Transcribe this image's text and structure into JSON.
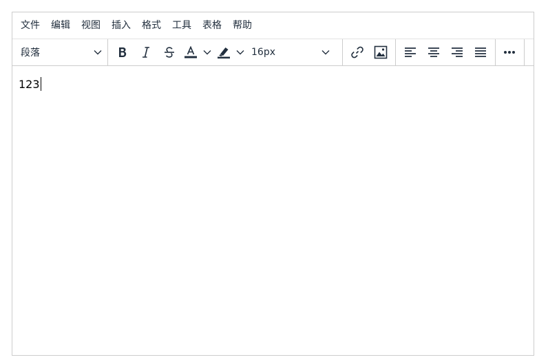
{
  "menubar": {
    "items": [
      {
        "id": "file",
        "label": "文件"
      },
      {
        "id": "edit",
        "label": "编辑"
      },
      {
        "id": "view",
        "label": "视图"
      },
      {
        "id": "insert",
        "label": "插入"
      },
      {
        "id": "format",
        "label": "格式"
      },
      {
        "id": "tools",
        "label": "工具"
      },
      {
        "id": "table",
        "label": "表格"
      },
      {
        "id": "help",
        "label": "帮助"
      }
    ]
  },
  "toolbar": {
    "block_format": "段落",
    "font_size": "16px",
    "icons": {
      "bold": "bold-icon",
      "italic": "italic-icon",
      "strikethrough": "strikethrough-icon",
      "text_color": "text-color-icon",
      "highlight": "highlight-icon",
      "link": "link-icon",
      "image": "image-icon",
      "align_left": "align-left-icon",
      "align_center": "align-center-icon",
      "align_right": "align-right-icon",
      "justify": "justify-icon",
      "more": "more-icon"
    }
  },
  "content": {
    "text": "123"
  },
  "colors": {
    "icon": "#222f3e",
    "border": "#cccccc"
  }
}
